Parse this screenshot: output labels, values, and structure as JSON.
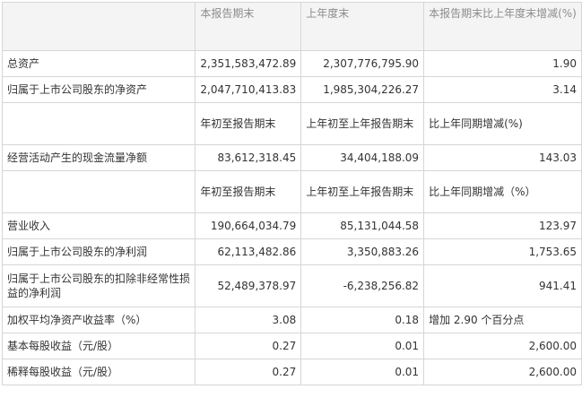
{
  "header": {
    "col1": "本报告期末",
    "col2": "上年度末",
    "col3": "本报告期末比上年度末增减(%)"
  },
  "rows_a": [
    {
      "label": "总资产",
      "v1": "2,351,583,472.89",
      "v2": "2,307,776,795.90",
      "v3": "1.90"
    },
    {
      "label": "归属于上市公司股东的净资产",
      "v1": "2,047,710,413.83",
      "v2": "1,985,304,226.27",
      "v3": "3.14"
    }
  ],
  "subheader_a": {
    "col1": "年初至报告期末",
    "col2": "上年初至上年报告期末",
    "col3": "比上年同期增减(%)"
  },
  "rows_b": [
    {
      "label": "经营活动产生的现金流量净额",
      "v1": "83,612,318.45",
      "v2": "34,404,188.09",
      "v3": "143.03"
    }
  ],
  "subheader_b": {
    "col1": "年初至报告期末",
    "col2": "上年初至上年报告期末",
    "col3": "比上年同期增减（%）"
  },
  "rows_c": [
    {
      "label": "营业收入",
      "v1": "190,664,034.79",
      "v2": "85,131,044.58",
      "v3": "123.97"
    },
    {
      "label": "归属于上市公司股东的净利润",
      "v1": "62,113,482.86",
      "v2": "3,350,883.26",
      "v3": "1,753.65"
    },
    {
      "label": "归属于上市公司股东的扣除非经常性损益的净利润",
      "v1": "52,489,378.97",
      "v2": "-6,238,256.82",
      "v3": "941.41"
    },
    {
      "label": "加权平均净资产收益率（%）",
      "v1": "3.08",
      "v2": "0.18",
      "v3": "增加 2.90 个百分点"
    },
    {
      "label": "基本每股收益（元/股）",
      "v1": "0.27",
      "v2": "0.01",
      "v3": "2,600.00"
    },
    {
      "label": "稀释每股收益（元/股）",
      "v1": "0.27",
      "v2": "0.01",
      "v3": "2,600.00"
    }
  ]
}
